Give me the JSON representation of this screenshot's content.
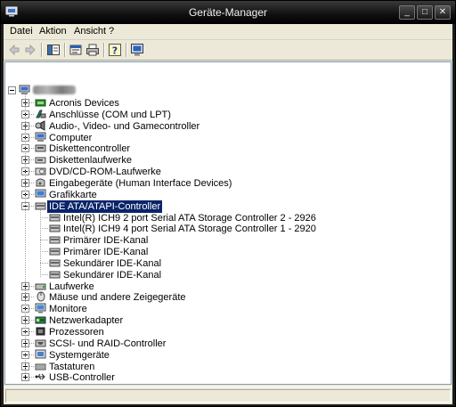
{
  "window": {
    "title": "Geräte-Manager"
  },
  "titlebar_buttons": {
    "minimize": "_",
    "maximize": "□",
    "close": "✕"
  },
  "menubar": {
    "items": [
      "Datei",
      "Aktion",
      "Ansicht",
      "?"
    ]
  },
  "toolbar": {
    "buttons": [
      "back-arrow-icon",
      "forward-arrow-icon",
      "show-hide-tree-icon",
      "properties-icon",
      "print-icon",
      "help-icon",
      "scan-hardware-icon"
    ]
  },
  "tree": {
    "root": {
      "label": ""
    },
    "categories": [
      {
        "label": "Acronis Devices",
        "icon": "acronis-icon"
      },
      {
        "label": "Anschlüsse (COM und LPT)",
        "icon": "port-icon"
      },
      {
        "label": "Audio-, Video- und Gamecontroller",
        "icon": "audio-icon"
      },
      {
        "label": "Computer",
        "icon": "computer-icon"
      },
      {
        "label": "Diskettencontroller",
        "icon": "floppy-controller-icon"
      },
      {
        "label": "Diskettenlaufwerke",
        "icon": "floppy-drive-icon"
      },
      {
        "label": "DVD/CD-ROM-Laufwerke",
        "icon": "cdrom-icon"
      },
      {
        "label": "Eingabegeräte (Human Interface Devices)",
        "icon": "hid-icon"
      },
      {
        "label": "Grafikkarte",
        "icon": "display-icon"
      },
      {
        "label": "IDE ATA/ATAPI-Controller",
        "icon": "ide-controller-icon",
        "expanded": true,
        "selected": true
      },
      {
        "label": "Laufwerke",
        "icon": "disk-drive-icon"
      },
      {
        "label": "Mäuse und andere Zeigegeräte",
        "icon": "mouse-icon"
      },
      {
        "label": "Monitore",
        "icon": "monitor-icon"
      },
      {
        "label": "Netzwerkadapter",
        "icon": "network-adapter-icon"
      },
      {
        "label": "Prozessoren",
        "icon": "processor-icon"
      },
      {
        "label": "SCSI- und RAID-Controller",
        "icon": "scsi-icon"
      },
      {
        "label": "Systemgeräte",
        "icon": "system-devices-icon"
      },
      {
        "label": "Tastaturen",
        "icon": "keyboard-icon"
      },
      {
        "label": "USB-Controller",
        "icon": "usb-icon"
      }
    ],
    "ide_children": [
      "Intel(R) ICH9 2 port Serial ATA Storage Controller 2 - 2926",
      "Intel(R) ICH9 4 port Serial ATA Storage Controller 1 - 2920",
      "Primärer IDE-Kanal",
      "Primärer IDE-Kanal",
      "Sekundärer IDE-Kanal",
      "Sekundärer IDE-Kanal"
    ]
  },
  "colors": {
    "selection": "#0a246a",
    "titlebar": "#121212",
    "chrome": "#ece9d8"
  }
}
